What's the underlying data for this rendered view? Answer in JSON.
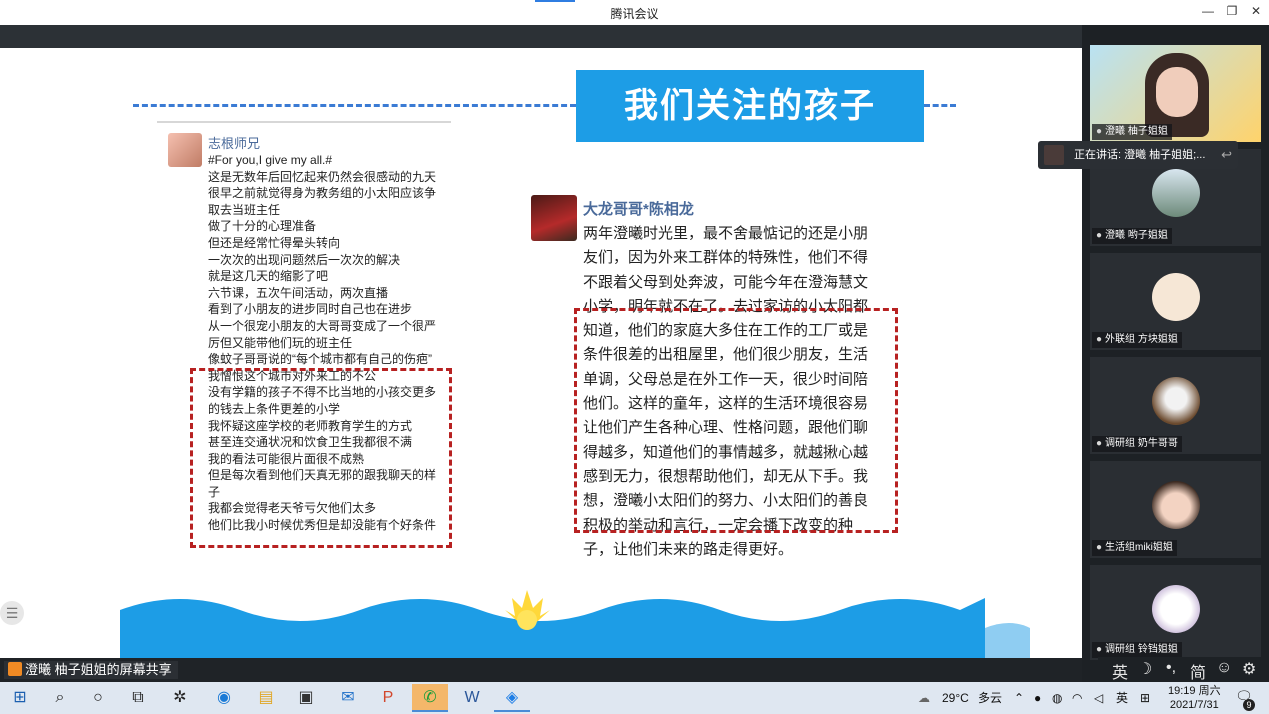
{
  "window": {
    "title": "腾讯会议",
    "minimize": "—",
    "restore": "❐",
    "close": "✕"
  },
  "slide": {
    "banner_title": "我们关注的孩子",
    "post1": {
      "author": "志根师兄",
      "lines": [
        "#For you,I give my all.#",
        "这是无数年后回忆起来仍然会很感动的九天",
        "很早之前就觉得身为教务组的小太阳应该争取去当班主任",
        "做了十分的心理准备",
        "但还是经常忙得晕头转向",
        "一次次的出现问题然后一次次的解决",
        "就是这几天的缩影了吧",
        "六节课，五次午间活动，两次直播",
        "看到了小朋友的进步同时自己也在进步",
        "从一个很宠小朋友的大哥哥变成了一个很严厉但又能带他们玩的班主任",
        "像蚊子哥哥说的“每个城市都有自己的伤疤”",
        "我憎恨这个城市对外来工的不公",
        "没有学籍的孩子不得不比当地的小孩交更多的钱去上条件更差的小学",
        "我怀疑这座学校的老师教育学生的方式",
        "甚至连交通状况和饮食卫生我都很不满",
        "我的看法可能很片面很不成熟",
        "但是每次看到他们天真无邪的跟我聊天的样子",
        "我都会觉得老天爷亏欠他们太多",
        "他们比我小时候优秀但是却没能有个好条件"
      ]
    },
    "post2": {
      "author": "大龙哥哥*陈相龙",
      "lines": [
        "两年澄曦时光里，最不舍最惦记的还是小朋",
        "友们，因为外来工群体的特殊性，他们不得",
        "不跟着父母到处奔波，可能今年在澄海慧文",
        "小学，明年就不在了。去过家访的小太阳都",
        "知道，他们的家庭大多住在工作的工厂或是",
        "条件很差的出租屋里，他们很少朋友，生活",
        "单调，父母总是在外工作一天，很少时间陪",
        "他们。这样的童年，这样的生活环境很容易",
        "让他们产生各种心理、性格问题，跟他们聊",
        "得越多，知道他们的事情越多，就越揪心越",
        "感到无力，很想帮助他们，却无从下手。我",
        "想，澄曦小太阳们的努力、小太阳们的善良",
        "积极的举动和言行，一定会播下改变的种",
        "子，让他们未来的路走得更好。"
      ]
    },
    "side_handle_icon": "list-icon"
  },
  "share_label": "澄曦 柚子姐姐的屏幕共享",
  "speaking_banner": "正在讲话: 澄曦 柚子姐姐;...",
  "participants": [
    {
      "label": "澄曦 柚子姐姐",
      "avatar": "video-girl"
    },
    {
      "label": "澄曦 哟子姐姐",
      "avatar": "photo-mountain"
    },
    {
      "label": "外联组 方块姐姐",
      "avatar": "pig-cartoon"
    },
    {
      "label": "调研组 奶牛哥哥",
      "avatar": "dog-photo"
    },
    {
      "label": "生活组miki姐姐",
      "avatar": "boy-photo"
    },
    {
      "label": "调研组 铃铛姐姐",
      "avatar": "cat-cartoon"
    }
  ],
  "ime_bar": {
    "lang": "英",
    "moon": "☽",
    "dot": "•,",
    "mode": "简",
    "emoji": "☺",
    "settings": "⚙"
  },
  "taskbar": {
    "weather_temp": "29°C",
    "weather_text": "多云",
    "ime": "英",
    "time": "19:19 周六",
    "date": "2021/7/31",
    "notif_count": "9"
  }
}
